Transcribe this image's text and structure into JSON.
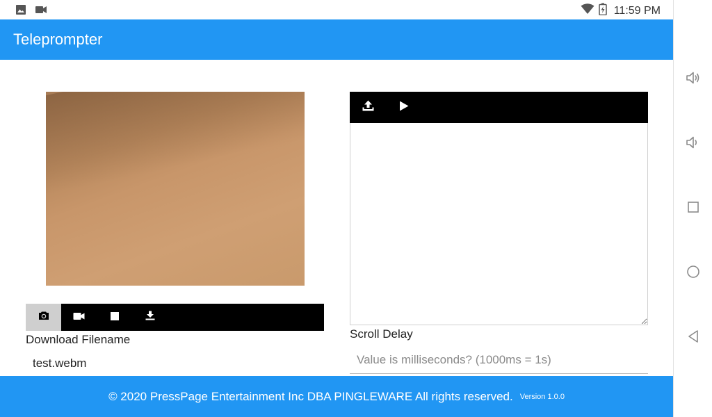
{
  "status_bar": {
    "time": "11:59 PM",
    "icons": [
      "image-icon",
      "video-camera-icon",
      "wifi-icon",
      "battery-charging-icon"
    ]
  },
  "app_bar": {
    "title": "Teleprompter"
  },
  "camera": {
    "toolbar": [
      {
        "name": "photo-camera-icon",
        "active": true
      },
      {
        "name": "video-camera-icon",
        "active": false
      },
      {
        "name": "stop-icon",
        "active": false
      },
      {
        "name": "download-icon",
        "active": false
      }
    ]
  },
  "download": {
    "label": "Download Filename",
    "value": "test.webm"
  },
  "script": {
    "toolbar": [
      "upload-icon",
      "play-icon"
    ],
    "text": ""
  },
  "scroll_delay": {
    "label": "Scroll Delay",
    "value": "",
    "placeholder": "Value is milliseconds? (1000ms = 1s)"
  },
  "footer": {
    "copyright": "© 2020 PressPage Entertainment Inc DBA PINGLEWARE  All rights reserved.",
    "version": "Version 1.0.0"
  },
  "nav_bar": [
    "volume-up-icon",
    "volume-down-icon",
    "recents-icon",
    "home-icon",
    "back-icon"
  ],
  "colors": {
    "primary": "#2196f3",
    "toolbar": "#000000",
    "active_tool": "#cfcfcf"
  }
}
